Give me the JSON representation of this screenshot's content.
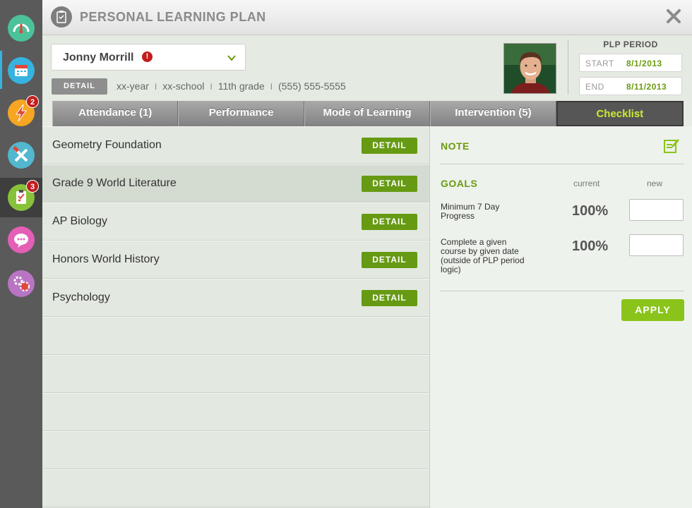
{
  "header": {
    "title": "PERSONAL LEARNING PLAN"
  },
  "sidebar": {
    "items": [
      {
        "icon": "speedometer-icon",
        "color": "#4cc29b",
        "badge": ""
      },
      {
        "icon": "calendar-icon",
        "color": "#36b3e0",
        "badge": ""
      },
      {
        "icon": "lightning-icon",
        "color": "#f6a623",
        "badge": "2"
      },
      {
        "icon": "tools-icon",
        "color": "#52b7cf",
        "badge": ""
      },
      {
        "icon": "clipboard-checklist-icon",
        "color": "#88c23a",
        "badge": "3"
      },
      {
        "icon": "chat-icon",
        "color": "#e45fb6",
        "badge": ""
      },
      {
        "icon": "settings-icon",
        "color": "#b975c4",
        "badge": ""
      }
    ]
  },
  "student": {
    "name": "Jonny Morrill",
    "alert": "!",
    "detail_label": "DETAIL",
    "year": "xx-year",
    "school": "xx-school",
    "grade": "11th grade",
    "phone": "(555) 555-5555",
    "separator": "I"
  },
  "plp_period": {
    "label": "PLP PERIOD",
    "start_label": "START",
    "start_value": "8/1/2013",
    "end_label": "END",
    "end_value": "8/11/2013"
  },
  "tabs": [
    {
      "label": "Attendance (1)",
      "active": false
    },
    {
      "label": "Performance",
      "active": false
    },
    {
      "label": "Mode of Learning",
      "active": false
    },
    {
      "label": "Intervention (5)",
      "active": false
    },
    {
      "label": "Checklist",
      "active": true
    }
  ],
  "courses": {
    "detail_label": "DETAIL",
    "items": [
      "Geometry Foundation",
      "Grade 9 World Literature",
      "AP Biology",
      "Honors World History",
      "Psychology"
    ]
  },
  "checklist": {
    "note_label": "NOTE",
    "goals_label": "GOALS",
    "col_current": "current",
    "col_new": "new",
    "goals": [
      {
        "text": "Minimum 7 Day Progress",
        "current": "100%",
        "new": ""
      },
      {
        "text": "Complete a given course by given date (outside of PLP period logic)",
        "current": "100%",
        "new": ""
      }
    ],
    "apply_label": "APPLY"
  },
  "colors": {
    "accent_green": "#6b9a10",
    "apply_green": "#8ac41a",
    "active_tab_text": "#c7e82f",
    "badge_red": "#c21d1d"
  }
}
